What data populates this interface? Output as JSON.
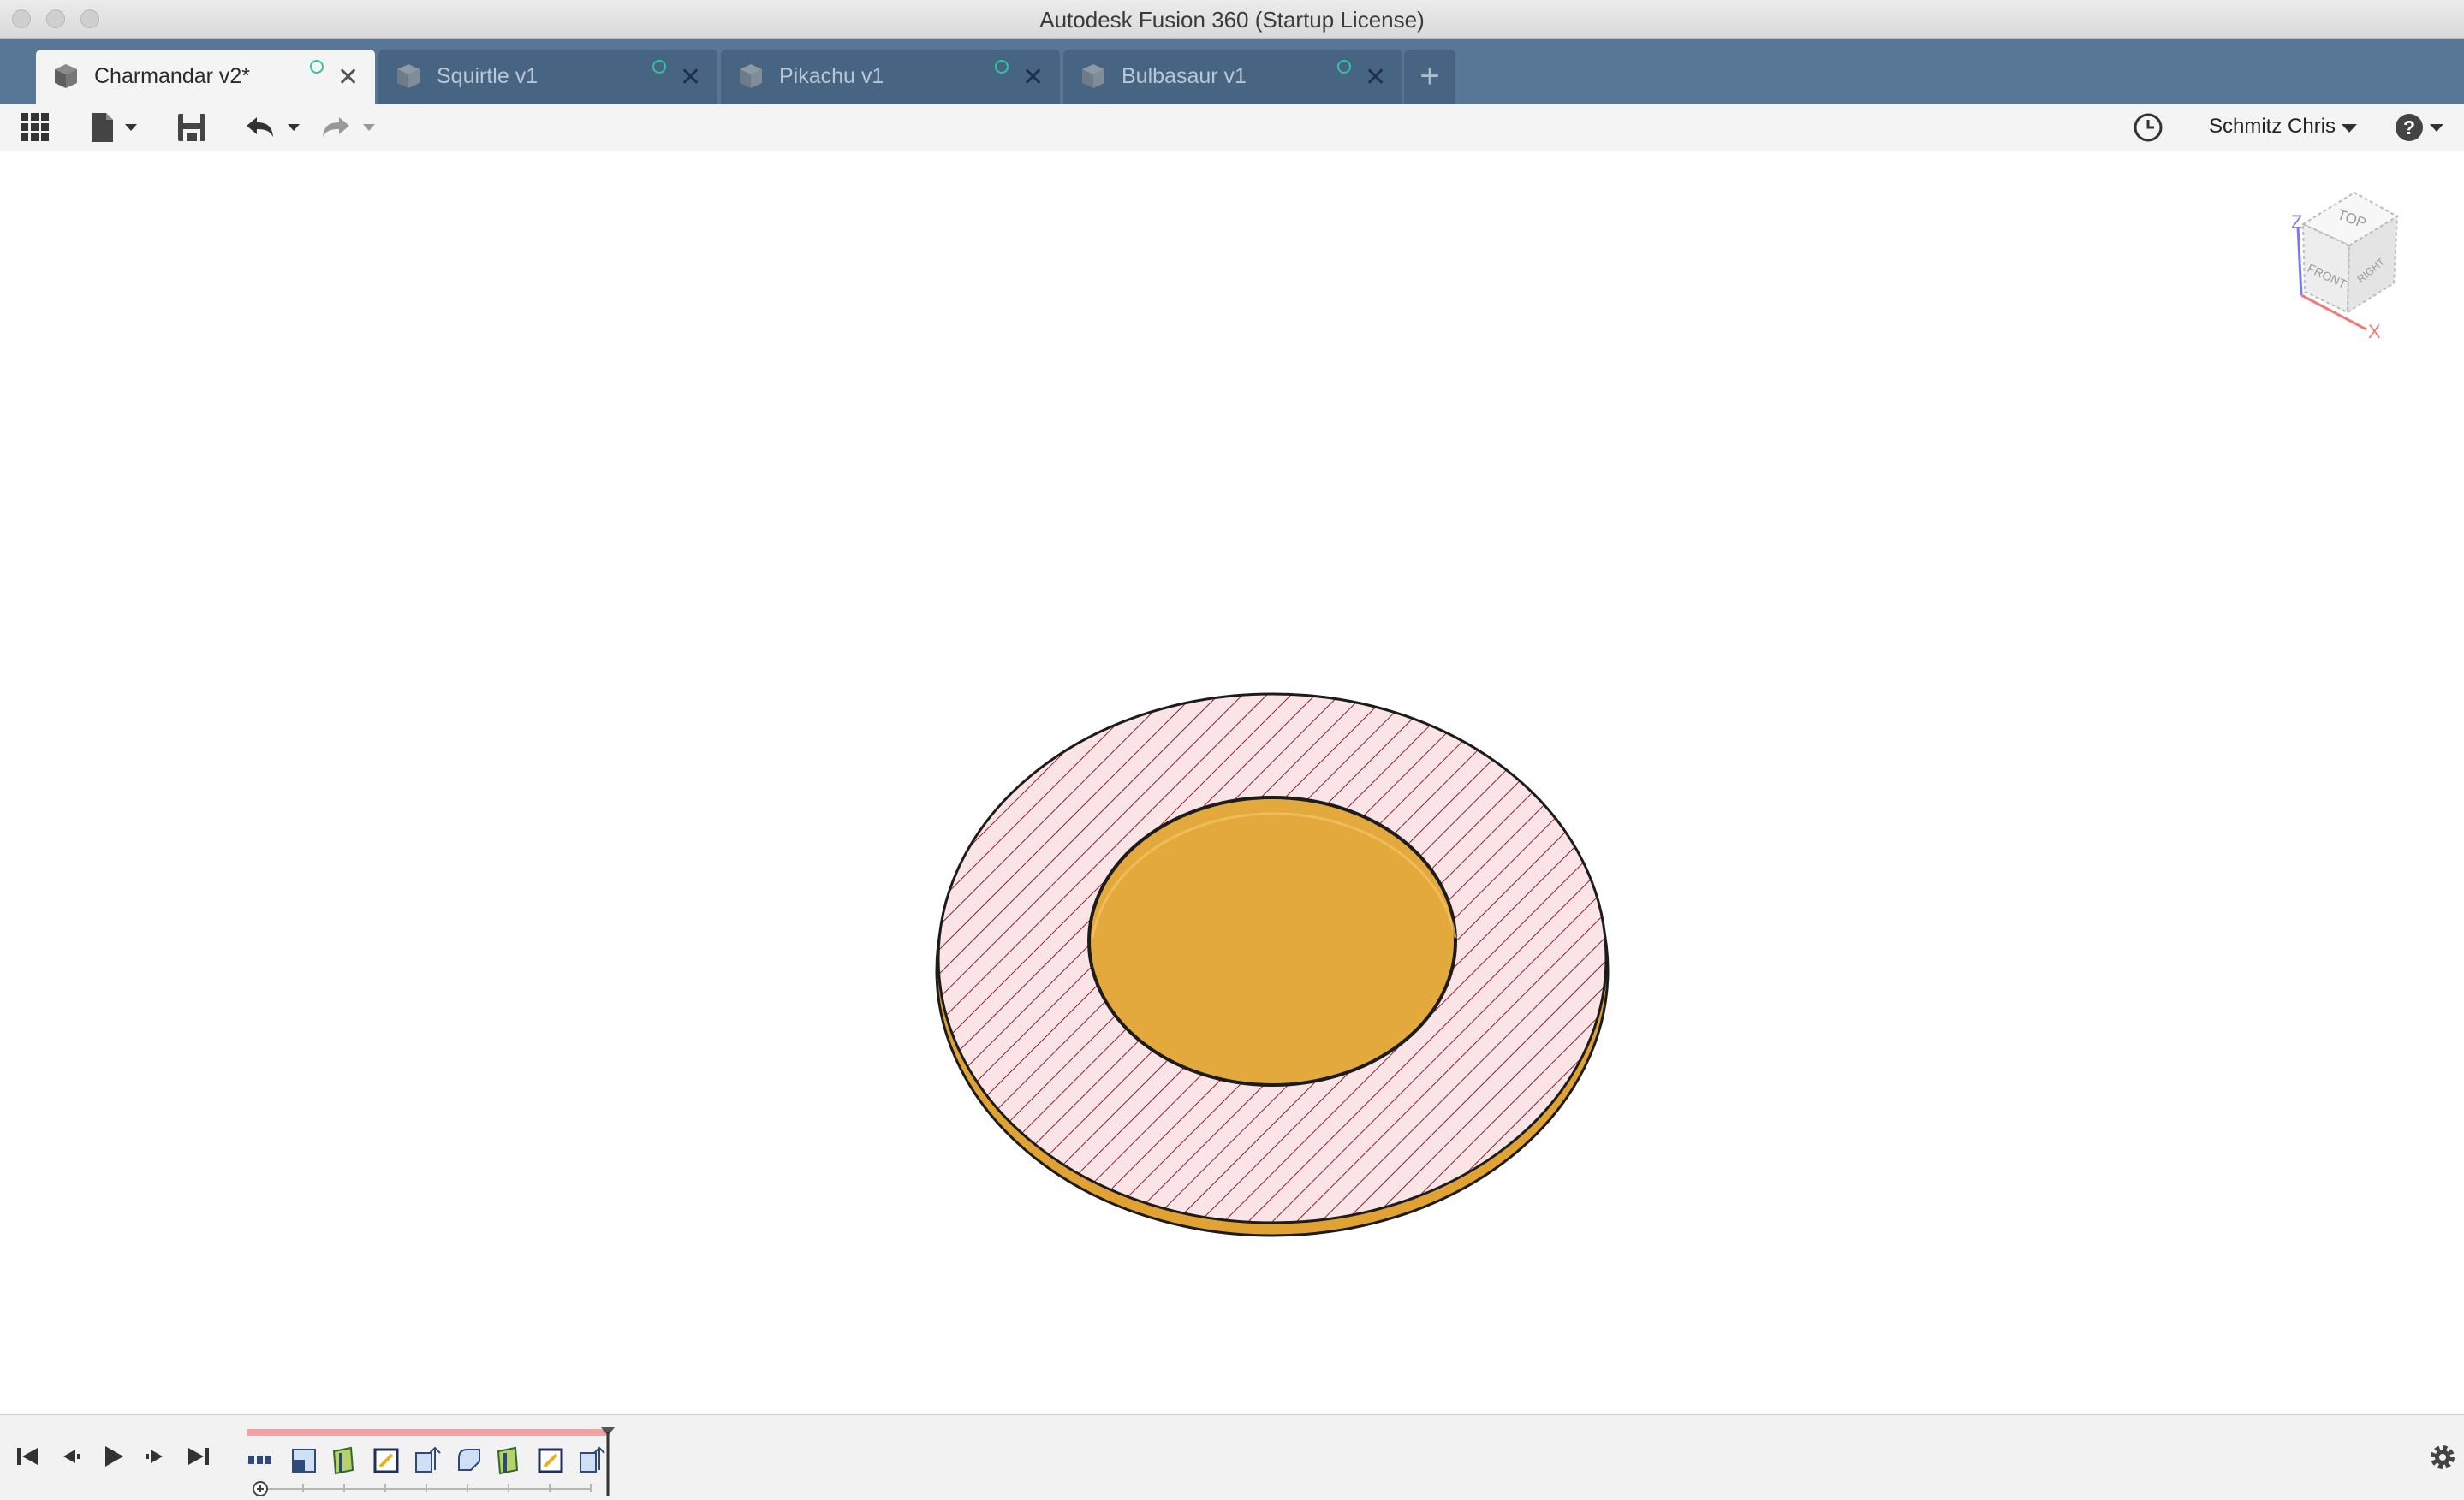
{
  "window": {
    "title": "Autodesk Fusion 360 (Startup License)"
  },
  "tabs": [
    {
      "label": "Charmandar v2*",
      "active": true
    },
    {
      "label": "Squirtle v1",
      "active": false
    },
    {
      "label": "Pikachu v1",
      "active": false
    },
    {
      "label": "Bulbasaur v1",
      "active": false
    }
  ],
  "tab_icons": {
    "document": "cube-icon",
    "status": "cloud-sync-status-icon",
    "close": "close-icon",
    "new": "plus-icon"
  },
  "toolbar": {
    "icons": [
      "grid-menu-icon",
      "file-icon",
      "save-icon",
      "undo-icon",
      "redo-icon",
      "history-clock-icon",
      "help-icon"
    ],
    "user_name": "Schmitz Chris"
  },
  "viewcube": {
    "top": "TOP",
    "front": "FRONT",
    "right": "RIGHT",
    "axis_z": "Z",
    "axis_x": "X"
  },
  "timeline": {
    "controls": [
      "skip-to-start-icon",
      "step-back-icon",
      "play-icon",
      "step-forward-icon",
      "skip-to-end-icon"
    ],
    "features": [
      "sketch-icon",
      "extrude-icon",
      "sketch-icon",
      "extrude-icon",
      "fillet-icon",
      "extrude-icon",
      "sketch-icon",
      "extrude-icon"
    ]
  },
  "colors": {
    "tab_strip": "#587695",
    "part_orange": "#e4a93c",
    "hatch_fill": "#fbe4e6",
    "hatch_line": "#8a1f2b",
    "timeline_marker": "#f2a2a2"
  }
}
